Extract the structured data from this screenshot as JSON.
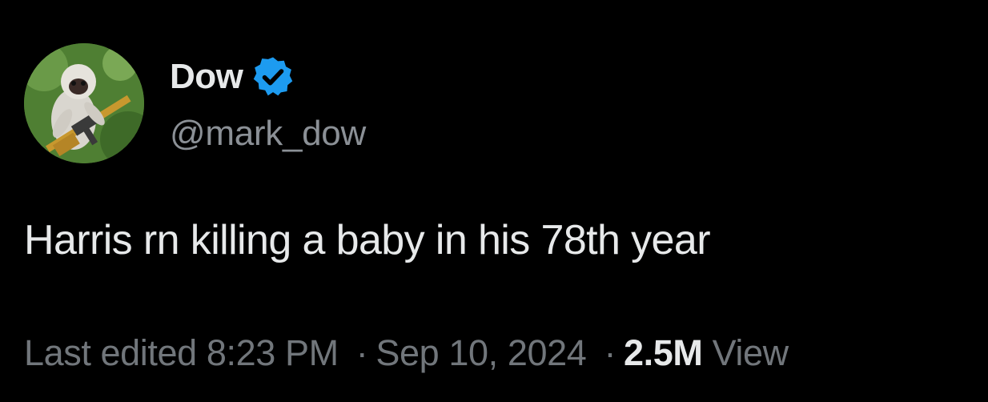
{
  "tweet": {
    "author": {
      "display_name": "Dow",
      "handle": "@mark_dow",
      "verified": true,
      "avatar_icon": "monkey-with-rifle-avatar"
    },
    "text": "Harris rn killing a baby in his 78th year",
    "meta": {
      "edited_label": "Last edited",
      "time": "8:23 PM",
      "date": "Sep 10, 2024",
      "separator": "·",
      "views_count": "2.5M",
      "views_label": "View"
    }
  },
  "colors": {
    "background": "#000000",
    "primary_text": "#e7e9ea",
    "secondary_text": "#71767b",
    "verified_blue": "#1d9bf0"
  }
}
